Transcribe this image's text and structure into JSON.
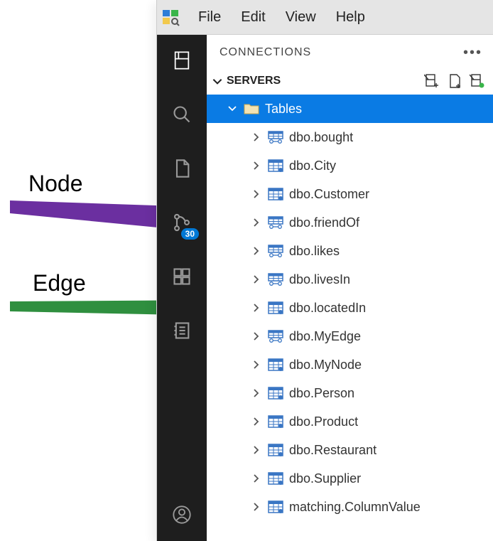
{
  "menu": {
    "items": [
      "File",
      "Edit",
      "View",
      "Help"
    ]
  },
  "panel": {
    "title": "CONNECTIONS"
  },
  "section": {
    "title": "SERVERS"
  },
  "source_control_badge": "30",
  "tables_node": {
    "label": "Tables"
  },
  "tables": [
    {
      "name": "dbo.bought",
      "edge": true
    },
    {
      "name": "dbo.City",
      "edge": false
    },
    {
      "name": "dbo.Customer",
      "edge": false
    },
    {
      "name": "dbo.friendOf",
      "edge": true
    },
    {
      "name": "dbo.likes",
      "edge": true
    },
    {
      "name": "dbo.livesIn",
      "edge": true
    },
    {
      "name": "dbo.locatedIn",
      "edge": false
    },
    {
      "name": "dbo.MyEdge",
      "edge": true
    },
    {
      "name": "dbo.MyNode",
      "edge": false
    },
    {
      "name": "dbo.Person",
      "edge": false
    },
    {
      "name": "dbo.Product",
      "edge": false
    },
    {
      "name": "dbo.Restaurant",
      "edge": false
    },
    {
      "name": "dbo.Supplier",
      "edge": false
    },
    {
      "name": "matching.ColumnValue",
      "edge": false
    }
  ],
  "annotations": {
    "node_label": "Node",
    "edge_label": "Edge",
    "node_color": "#6b2fa0",
    "edge_color": "#2f8f3f"
  }
}
